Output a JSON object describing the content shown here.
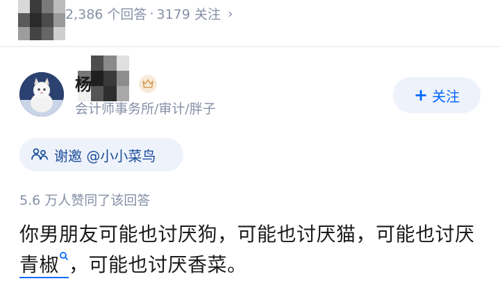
{
  "question_bar": {
    "answers_count": "2,386 个回答",
    "separator": "·",
    "followers_count": "3179 关注",
    "chevron": "›"
  },
  "author": {
    "name": "杨",
    "headline": "会计师事务所/审计/胖子",
    "badge_icon": "crown-badge-icon"
  },
  "follow_button": {
    "plus": "+",
    "label": "关注"
  },
  "invite": {
    "label": "谢邀 @小小菜鸟"
  },
  "votes": {
    "text": "5.6 万人赞同了该回答"
  },
  "answer": {
    "part1": "你男朋友可能也讨厌狗，可能也讨厌猫，可能也讨厌",
    "keyword": "青椒",
    "part2": "，可能也讨厌香菜。"
  },
  "colors": {
    "accent": "#0066ff",
    "muted_text": "#8590a6",
    "chip_bg": "#eef2fb",
    "badge_bg": "#f7ead9"
  }
}
